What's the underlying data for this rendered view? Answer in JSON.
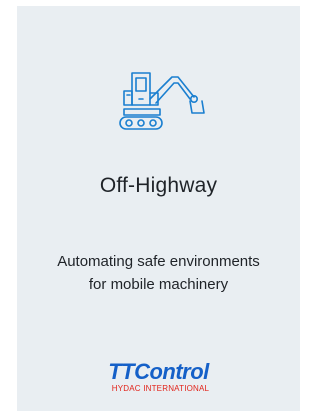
{
  "card": {
    "icon": "excavator-icon",
    "title": "Off-Highway",
    "description": "Automating safe environments for mobile machinery",
    "logo": {
      "brand": "TTControl",
      "subline": "HYDAC INTERNATIONAL"
    }
  },
  "colors": {
    "card_background": "#e9eef2",
    "icon_stroke": "#1a7fd0",
    "text": "#1f2328",
    "logo_blue": "#1560c8",
    "logo_red": "#e2231a"
  }
}
